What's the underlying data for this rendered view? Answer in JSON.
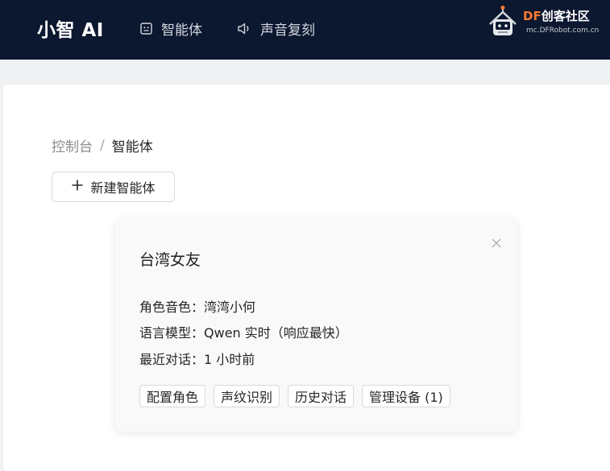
{
  "header": {
    "brand": "小智 AI",
    "nav": [
      {
        "label": "智能体",
        "icon": "agent-icon"
      },
      {
        "label": "声音复刻",
        "icon": "speaker-icon"
      }
    ],
    "partner": {
      "title_accent": "DF",
      "title_rest": "创客社区",
      "subtitle": "mc.DFRobot.com.cn",
      "accent_color": "#ff7a2f"
    }
  },
  "breadcrumb": {
    "root": "控制台",
    "separator": "/",
    "current": "智能体"
  },
  "toolbar": {
    "new_agent_label": "新建智能体"
  },
  "agent_card": {
    "name": "台湾女友",
    "voice_label": "角色音色：",
    "voice_value": "湾湾小何",
    "model_label": "语言模型：",
    "model_value": "Qwen 实时（响应最快）",
    "recent_label": "最近对话：",
    "recent_value": "1 小时前",
    "actions": [
      "配置角色",
      "声纹识别",
      "历史对话",
      "管理设备 (1)"
    ]
  },
  "colors": {
    "header_bg": "#0c1730",
    "page_bg": "#f0f1f3",
    "card_bg": "#f9f9f9"
  }
}
